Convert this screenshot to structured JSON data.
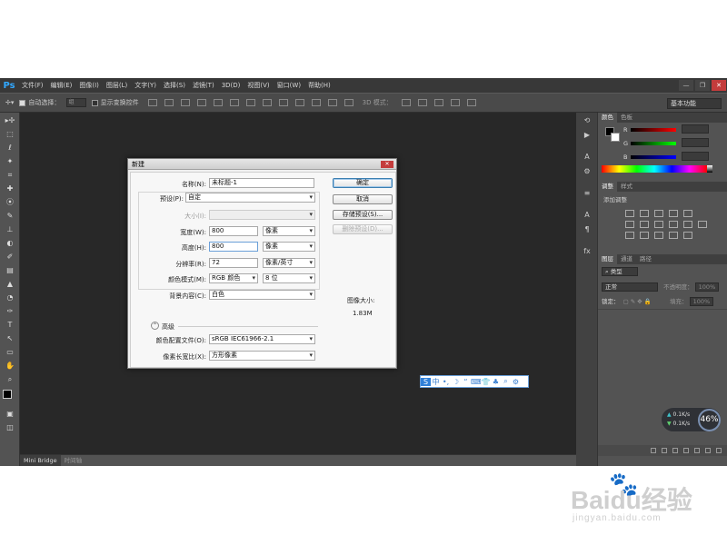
{
  "app": {
    "logo": "Ps"
  },
  "menubar": {
    "items": [
      "文件(F)",
      "编辑(E)",
      "图像(I)",
      "图层(L)",
      "文字(Y)",
      "选择(S)",
      "滤镜(T)",
      "3D(D)",
      "视图(V)",
      "窗口(W)",
      "帮助(H)"
    ]
  },
  "window_controls": {
    "minimize": "—",
    "restore": "❐",
    "close": "✕"
  },
  "options_bar": {
    "auto_select_label": "自动选择：",
    "auto_select_value": "组",
    "show_transform_label": "显示变换控件",
    "mode_3d_label": "3D 模式：",
    "workspace": "基本功能"
  },
  "tools": [
    "▸✢",
    "⬚",
    "ℓ",
    "✦",
    "⌗",
    "✚",
    "⦿",
    "✎",
    "⊥",
    "◐",
    "✐",
    "▤",
    "▲",
    "◔",
    "✑",
    "T",
    "↖",
    "▭",
    "✋",
    "⌕",
    "▣",
    "◫"
  ],
  "side_icons": [
    "⟲",
    "▶",
    "A",
    "⚙",
    "≡",
    "A",
    "¶",
    "fx"
  ],
  "status_tabs": {
    "mini_bridge": "Mini Bridge",
    "timeline": "时间轴"
  },
  "ime": [
    "S",
    "中",
    "•,",
    "☽",
    "“",
    "⌨",
    "👕",
    "♣",
    "⌕",
    "⚙"
  ],
  "color_panel": {
    "tabs": [
      "颜色",
      "色板"
    ],
    "r": "R",
    "g": "G",
    "b": "B"
  },
  "adjust_panel": {
    "tabs": [
      "调整",
      "样式"
    ],
    "hint": "添加调整"
  },
  "layers_panel": {
    "tabs": [
      "图层",
      "通道",
      "路径"
    ],
    "kind": "类型",
    "blend": "正常",
    "opacity_label": "不透明度：",
    "opacity_value": "100%",
    "lock_label": "锁定：",
    "fill_label": "填充：",
    "fill_value": "100%"
  },
  "network": {
    "up": "0.1K/s",
    "down": "0.1K/s",
    "percent": "46%"
  },
  "dialog": {
    "title": "新建",
    "close": "✕",
    "name_label": "名称(N):",
    "name_value": "未标题-1",
    "preset_label": "预设(P):",
    "preset_value": "自定",
    "size_label": "大小(I):",
    "size_value": "",
    "width_label": "宽度(W):",
    "width_value": "800",
    "width_unit": "像素",
    "height_label": "高度(H):",
    "height_value": "800",
    "height_unit": "像素",
    "resolution_label": "分辨率(R):",
    "resolution_value": "72",
    "resolution_unit": "像素/英寸",
    "color_mode_label": "颜色模式(M):",
    "color_mode_value": "RGB 颜色",
    "bit_depth": "8 位",
    "background_label": "背景内容(C):",
    "background_value": "白色",
    "advanced_label": "高级",
    "profile_label": "颜色配置文件(O):",
    "profile_value": "sRGB IEC61966-2.1",
    "aspect_label": "像素长宽比(X):",
    "aspect_value": "方形像素",
    "ok": "确定",
    "cancel": "取消",
    "save_preset": "存储预设(S)...",
    "delete_preset": "删除预设(D)...",
    "image_size_label": "图像大小:",
    "image_size_value": "1.83M"
  },
  "watermark": {
    "brand": "Baidu经验",
    "url": "jingyan.baidu.com"
  }
}
